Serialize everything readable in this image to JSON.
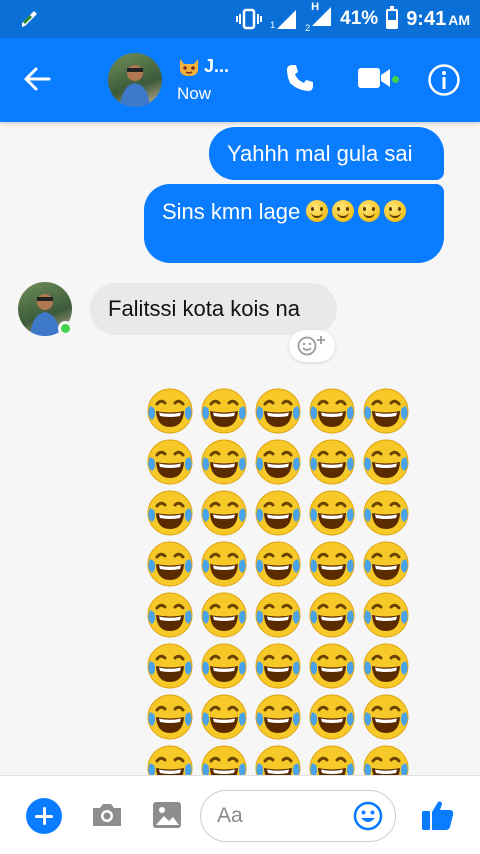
{
  "status_bar": {
    "battery_percent_text": "41%",
    "battery_level": 0.41,
    "time": "9:41",
    "ampm": "AM",
    "sim1_label": "1",
    "sim2_label": "2",
    "network_type": "H"
  },
  "header": {
    "contact_name": "J...",
    "contact_status": "Now",
    "accent_color": "#0a7cff"
  },
  "messages": {
    "outgoing_1": "Yahhh mal gula sai",
    "outgoing_2_text": "Sins kmn lage",
    "outgoing_2_smile_count": 4,
    "incoming_1": "Falitssi kota kois na",
    "emoji_sticker": "face-with-tears-of-joy",
    "emoji_grid_columns": 5,
    "emoji_grid_rows_visible": 8
  },
  "composer": {
    "placeholder": "Aa"
  },
  "icons": {
    "status": [
      "pen-icon",
      "vibrate-icon",
      "signal-icon",
      "battery-icon"
    ],
    "header": [
      "back-arrow-icon",
      "phone-icon",
      "video-camera-icon",
      "info-icon"
    ],
    "composer": [
      "plus-icon",
      "camera-icon",
      "image-icon",
      "emoji-icon",
      "thumbs-up-icon"
    ]
  }
}
